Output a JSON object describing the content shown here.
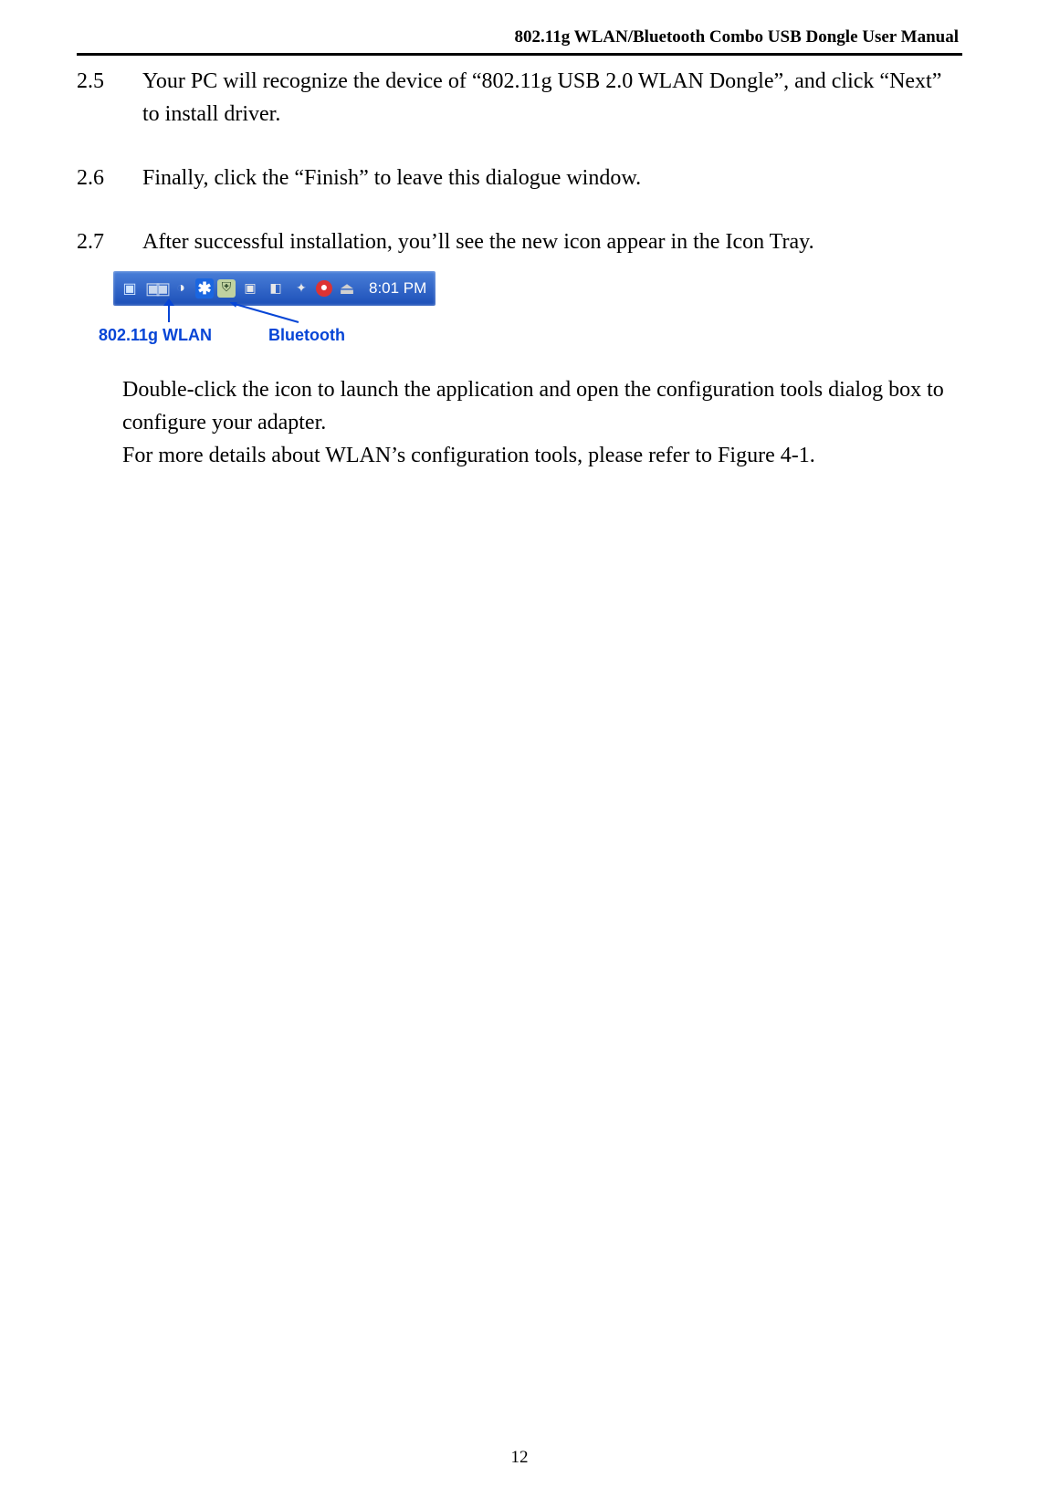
{
  "header": {
    "title": "802.11g WLAN/Bluetooth Combo USB Dongle User Manual"
  },
  "steps": {
    "s25": {
      "num": "2.5",
      "text": "Your PC will recognize the device of “802.11g USB 2.0 WLAN Dongle”, and click “Next” to install driver."
    },
    "s26": {
      "num": "2.6",
      "text": "Finally, click the “Finish” to leave this dialogue window."
    },
    "s27": {
      "num": "2.7",
      "text": "After successful installation, you’ll see the new icon appear in the Icon Tray."
    }
  },
  "tray": {
    "time": "8:01 PM",
    "label_wlan": "802.11g WLAN",
    "label_bt": "Bluetooth",
    "icons": {
      "wlan": "wlan-monitor-icon",
      "monitors": "dual-monitors-icon",
      "volume": "volume-icon",
      "bluetooth": "bluetooth-icon",
      "shield": "security-shield-icon",
      "net1": "network-icon",
      "net2": "network-icon",
      "av": "antivirus-icon",
      "stop": "stop-icon",
      "usb": "safely-remove-icon"
    }
  },
  "paragraphs": {
    "p1": "Double-click the icon to launch the application and open the configuration tools dialog box to configure your adapter.",
    "p2": "For more details about WLAN’s configuration tools, please refer to Figure 4-1."
  },
  "footer": {
    "page": "12"
  }
}
